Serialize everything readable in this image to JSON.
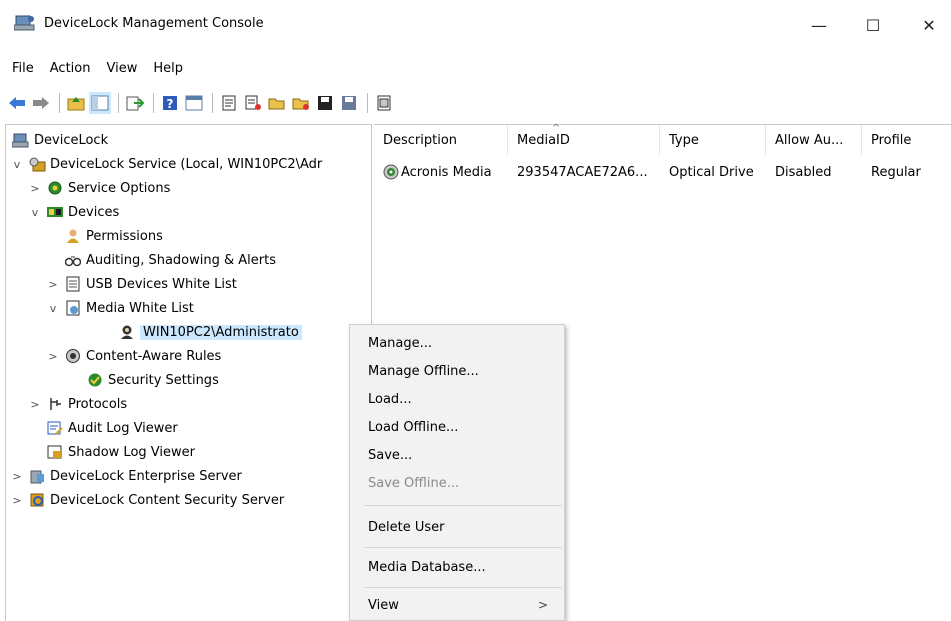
{
  "window": {
    "title": "DeviceLock Management Console",
    "minimize": "—",
    "maximize": "☐",
    "close": "✕"
  },
  "menu": [
    "File",
    "Action",
    "View",
    "Help"
  ],
  "toolbar_icons": [
    "back-icon",
    "forward-icon",
    "up-folder-icon",
    "show-tree-icon",
    "export-icon",
    "help-icon",
    "properties-icon",
    "policy-icon",
    "policy-add-icon",
    "open-icon",
    "open-offline-icon",
    "save-icon",
    "save-offline-icon",
    "report-icon"
  ],
  "tree": {
    "items": [
      {
        "label": "DeviceLock",
        "icon": "computer-icon"
      },
      {
        "label": "DeviceLock Service (Local, WIN10PC2\\Adr",
        "icon": "service-icon",
        "exp": "v"
      },
      {
        "label": "Service Options",
        "icon": "gear-icon",
        "exp": ">"
      },
      {
        "label": "Devices",
        "icon": "devices-icon",
        "exp": "v"
      },
      {
        "label": "Permissions",
        "icon": "permissions-icon"
      },
      {
        "label": "Auditing, Shadowing & Alerts",
        "icon": "binoculars-icon"
      },
      {
        "label": "USB Devices White List",
        "icon": "usb-list-icon",
        "exp": ">"
      },
      {
        "label": "Media White List",
        "icon": "media-list-icon",
        "exp": "v"
      },
      {
        "label": "WIN10PC2\\Administrato",
        "icon": "user-icon"
      },
      {
        "label": "Content-Aware Rules",
        "icon": "content-rules-icon",
        "exp": ">"
      },
      {
        "label": "Security Settings",
        "icon": "security-icon"
      },
      {
        "label": "Protocols",
        "icon": "protocols-icon",
        "exp": ">"
      },
      {
        "label": "Audit Log Viewer",
        "icon": "audit-log-icon"
      },
      {
        "label": "Shadow Log Viewer",
        "icon": "shadow-log-icon"
      },
      {
        "label": "DeviceLock Enterprise Server",
        "icon": "enterprise-server-icon",
        "exp": ">"
      },
      {
        "label": "DeviceLock Content Security Server",
        "icon": "content-server-icon",
        "exp": ">"
      }
    ]
  },
  "list": {
    "columns": [
      "Description",
      "MediaID",
      "Type",
      "Allow Au...",
      "Profile"
    ],
    "rows": [
      {
        "description": "Acronis Media",
        "media_id": "293547ACAE72A6...",
        "type": "Optical Drive",
        "allow_au": "Disabled",
        "profile": "Regular"
      }
    ]
  },
  "context_menu": {
    "items": [
      {
        "label": "Manage..."
      },
      {
        "label": "Manage Offline..."
      },
      {
        "label": "Load..."
      },
      {
        "label": "Load Offline..."
      },
      {
        "label": "Save..."
      },
      {
        "label": "Save Offline...",
        "disabled": true
      },
      {
        "label": "Delete User"
      },
      {
        "label": "Media Database..."
      },
      {
        "label": "View",
        "submenu_arrow": ">"
      }
    ]
  },
  "colors": {
    "selection": "#cce8ff",
    "menu_bg": "#f2f2f2"
  }
}
